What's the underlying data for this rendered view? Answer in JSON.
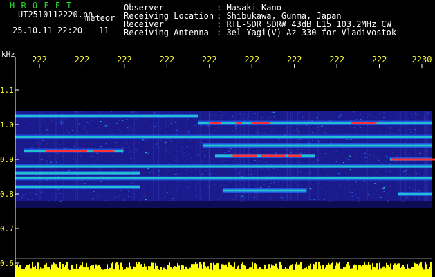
{
  "header": {
    "app_name": "H R O F F T",
    "file_name": "UT2510112220.pn",
    "event_label": "meteor",
    "datetime": "25.10.11 22:20",
    "small_label": "11_"
  },
  "info": [
    {
      "label": "Observer",
      "value": ": Masaki Kano"
    },
    {
      "label": "Receiving Location",
      "value": ": Shibukawa, Gunma, Japan"
    },
    {
      "label": "Receiver",
      "value": ": RTL-SDR SDR# 43dB L15 103.2MHz CW"
    },
    {
      "label": "Receiving Antenna",
      "value": ": 3el Yagi(V) Az 330 for Vladivostok"
    }
  ],
  "chart_data": {
    "type": "heatmap",
    "ylabel": "kHz",
    "ylim": [
      0.6,
      1.2
    ],
    "x_tick_labels": [
      "222",
      "222",
      "222",
      "222",
      "222",
      "222",
      "222",
      "222",
      "222",
      "2230"
    ],
    "y_tick_labels": [
      "1.1",
      "1.0",
      "0.9",
      "0.8",
      "0.7",
      "0.6"
    ],
    "y_ticks": [
      1.1,
      1.0,
      0.9,
      0.8,
      0.7,
      0.6
    ],
    "grid": false,
    "colors": {
      "tick_label": "#ffff33",
      "axis": "#ffffff",
      "background_noise": "#1a1a8c",
      "strong_signal": "#ff3333",
      "medium_signal": "#22cccc",
      "weak_signal": "#2266ff",
      "power_bar": "#ffff00"
    },
    "signal_bands": [
      {
        "freq": 1.025,
        "x_start": 0.0,
        "x_end": 0.44,
        "intensity": 0.7
      },
      {
        "freq": 1.005,
        "x_start": 0.44,
        "x_end": 1.0,
        "intensity": 0.85
      },
      {
        "freq": 0.965,
        "x_start": 0.0,
        "x_end": 1.0,
        "intensity": 0.45
      },
      {
        "freq": 0.94,
        "x_start": 0.45,
        "x_end": 1.0,
        "intensity": 0.6
      },
      {
        "freq": 0.925,
        "x_start": 0.02,
        "x_end": 0.26,
        "intensity": 0.9
      },
      {
        "freq": 0.91,
        "x_start": 0.48,
        "x_end": 0.72,
        "intensity": 0.85
      },
      {
        "freq": 0.9,
        "x_start": 0.9,
        "x_end": 1.0,
        "intensity": 0.9
      },
      {
        "freq": 0.88,
        "x_start": 0.0,
        "x_end": 1.0,
        "intensity": 0.5
      },
      {
        "freq": 0.86,
        "x_start": 0.0,
        "x_end": 0.3,
        "intensity": 0.55
      },
      {
        "freq": 0.845,
        "x_start": 0.0,
        "x_end": 1.0,
        "intensity": 0.75
      },
      {
        "freq": 0.82,
        "x_start": 0.0,
        "x_end": 0.3,
        "intensity": 0.4
      },
      {
        "freq": 0.81,
        "x_start": 0.5,
        "x_end": 0.7,
        "intensity": 0.45
      },
      {
        "freq": 0.8,
        "x_start": 0.92,
        "x_end": 1.0,
        "intensity": 0.6
      }
    ],
    "noise_region": {
      "freq_top": 1.04,
      "freq_bottom": 0.78,
      "freq_edge_bottom": 0.76
    }
  }
}
